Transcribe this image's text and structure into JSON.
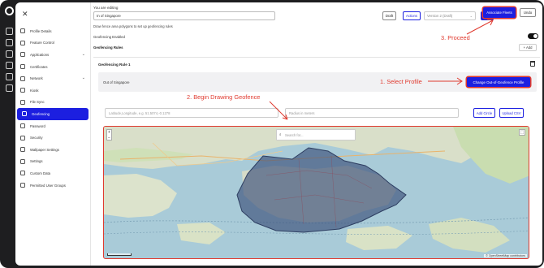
{
  "top": {
    "editing_label": "You are editing",
    "editing_value": "In of Singapore",
    "draft_label": "Draft",
    "actions_label": "Actions",
    "version_label": "Version 2 (Draft)",
    "save_label": "Save",
    "associate_label": "Associate Fleets",
    "undo_label": "Undo"
  },
  "sidebar": {
    "items": [
      {
        "label": "Profile Details",
        "icon": "document-icon"
      },
      {
        "label": "Feature Control",
        "icon": "sliders-icon"
      },
      {
        "label": "Applications",
        "icon": "apps-icon",
        "chevron": "⌄"
      },
      {
        "label": "Certificates",
        "icon": "certificate-icon"
      },
      {
        "label": "Network",
        "icon": "network-icon",
        "chevron": "⌄"
      },
      {
        "label": "Kiosk",
        "icon": "kiosk-icon"
      },
      {
        "label": "File Sync",
        "icon": "sync-icon"
      },
      {
        "label": "Geofencing",
        "icon": "geofence-icon",
        "active": true
      },
      {
        "label": "Password",
        "icon": "key-icon"
      },
      {
        "label": "Security",
        "icon": "shield-icon"
      },
      {
        "label": "Wallpaper Settings",
        "icon": "image-icon"
      },
      {
        "label": "Settings",
        "icon": "gear-icon"
      },
      {
        "label": "Custom Data",
        "icon": "data-icon"
      },
      {
        "label": "Permitted User Groups",
        "icon": "users-icon"
      }
    ]
  },
  "geofencing": {
    "help_text": "Draw fence area polygons to set up geofencing rules",
    "enabled_label": "Geofencing Enabled",
    "rules_label": "Geofencing Rules",
    "add_label": "+ Add",
    "rule_title": "Geofencing Rule 1",
    "profile_label": "Out of Singapore",
    "change_button": "Change Out-of-Geofence Profile",
    "coord_placeholder": "Latitude,Longitude, e.g. 51.5074,-0.1278",
    "radius_placeholder": "Radius in meters",
    "add_circle": "Add Circle",
    "upload_csv": "Upload CSV",
    "map_search_placeholder": "Search for...",
    "map_attribution": "© OpenStreetMap contributors",
    "zoom_in": "+",
    "zoom_out": "−"
  },
  "annotations": {
    "step1": "1. Select Profile",
    "step2": "2. Begin Drawing Geofence",
    "step3": "3. Proceed"
  },
  "colors": {
    "accent": "#1c1fe0",
    "annotation": "#e03a2f",
    "geofence_fill": "#3b4f79"
  }
}
